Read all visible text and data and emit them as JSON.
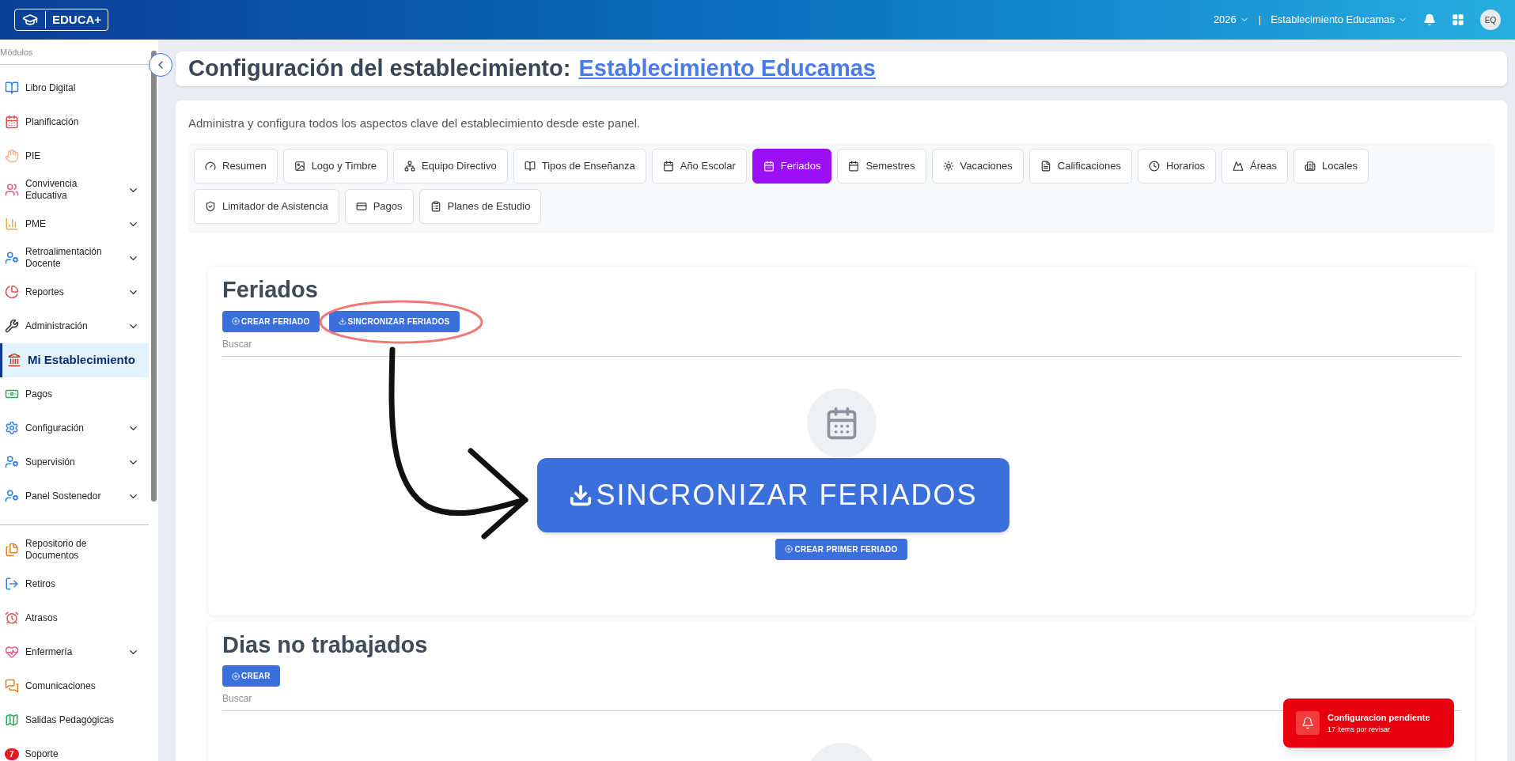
{
  "topbar": {
    "logo_text": "EDUCA+",
    "year": "2026",
    "separator": "|",
    "establishment": "Establecimiento Educamas",
    "avatar": "EQ"
  },
  "sidebar": {
    "heading": "Módulos",
    "groups": [
      [
        {
          "label": "Libro Digital",
          "expandable": false,
          "selected": false
        },
        {
          "label": "Planificación",
          "expandable": false,
          "selected": false
        },
        {
          "label": "PIE",
          "expandable": false,
          "selected": false
        },
        {
          "label": "Convivencia Educativa",
          "expandable": true,
          "selected": false
        },
        {
          "label": "PME",
          "expandable": true,
          "selected": false
        },
        {
          "label": "Retroalimentación Docente",
          "expandable": true,
          "selected": false
        },
        {
          "label": "Reportes",
          "expandable": true,
          "selected": false
        },
        {
          "label": "Administración",
          "expandable": true,
          "selected": false
        },
        {
          "label": "Mi Establecimiento",
          "expandable": false,
          "selected": true
        },
        {
          "label": "Pagos",
          "expandable": false,
          "selected": false
        },
        {
          "label": "Configuración",
          "expandable": true,
          "selected": false
        },
        {
          "label": "Supervisión",
          "expandable": true,
          "selected": false
        },
        {
          "label": "Panel Sostenedor",
          "expandable": true,
          "selected": false
        }
      ],
      [
        {
          "label": "Repositorio de Documentos",
          "expandable": false,
          "selected": false
        },
        {
          "label": "Retiros",
          "expandable": false,
          "selected": false
        },
        {
          "label": "Atrasos",
          "expandable": false,
          "selected": false
        },
        {
          "label": "Enfermería",
          "expandable": true,
          "selected": false
        },
        {
          "label": "Comunicaciones",
          "expandable": false,
          "selected": false
        },
        {
          "label": "Salidas Pedagógicas",
          "expandable": false,
          "selected": false
        },
        {
          "label": "Soporte",
          "expandable": false,
          "selected": false,
          "badge": "7"
        }
      ]
    ]
  },
  "header": {
    "title": "Configuración del establecimiento:",
    "link": "Establecimiento Educamas"
  },
  "description": "Administra y configura todos los aspectos clave del establecimiento desde este panel.",
  "tabs": [
    {
      "label": "Resumen",
      "selected": false
    },
    {
      "label": "Logo y Timbre",
      "selected": false
    },
    {
      "label": "Equipo Directivo",
      "selected": false
    },
    {
      "label": "Tipos de Enseñanza",
      "selected": false
    },
    {
      "label": "Año Escolar",
      "selected": false
    },
    {
      "label": "Feriados",
      "selected": true
    },
    {
      "label": "Semestres",
      "selected": false
    },
    {
      "label": "Vacaciones",
      "selected": false
    },
    {
      "label": "Calificaciones",
      "selected": false
    },
    {
      "label": "Horarios",
      "selected": false
    },
    {
      "label": "Áreas",
      "selected": false
    },
    {
      "label": "Locales",
      "selected": false
    },
    {
      "label": "Limitador de Asistencia",
      "selected": false
    },
    {
      "label": "Pagos",
      "selected": false
    },
    {
      "label": "Planes de Estudio",
      "selected": false
    }
  ],
  "feriados": {
    "title": "Feriados",
    "buttons": [
      {
        "label": "CREAR FERIADO",
        "kind": "create"
      },
      {
        "label": "SINCRONIZAR FERIADOS",
        "kind": "sync"
      }
    ],
    "search_placeholder": "Buscar",
    "callout": "SINCRONIZAR FERIADOS",
    "empty_button": "CREAR PRIMER FERIADO"
  },
  "dias": {
    "title": "Dias no trabajados",
    "buttons": [
      {
        "label": "CREAR",
        "kind": "create"
      }
    ],
    "search_placeholder": "Buscar"
  },
  "toast": {
    "title": "Configuracion pendiente",
    "subtitle": "17 items por revisar"
  }
}
